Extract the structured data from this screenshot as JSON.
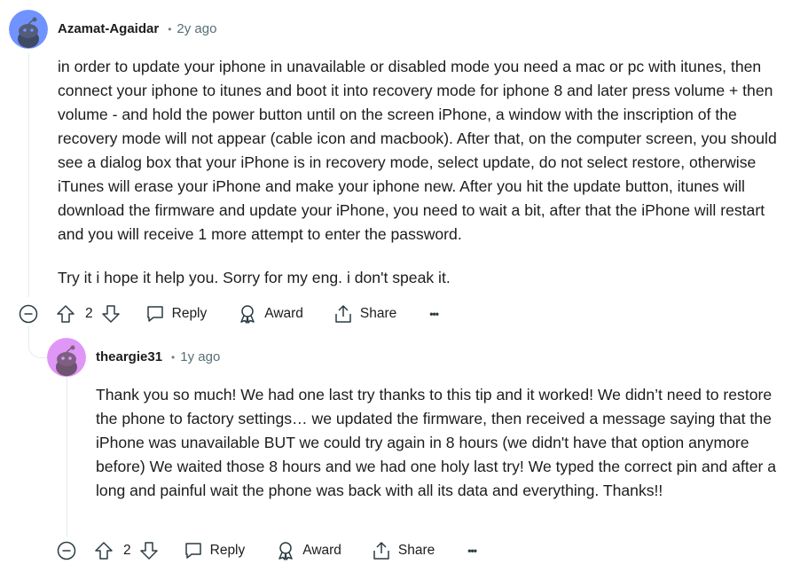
{
  "comments": [
    {
      "author": "Azamat-Agaidar",
      "time": "2y ago",
      "paragraphs": [
        "in order to update your iphone in unavailable or disabled mode you need a mac or pc with itunes, then connect your iphone to itunes and boot it into recovery mode for iphone 8 and later press volume + then volume - and hold the power button until on the screen iPhone, a window with the inscription of the recovery mode will not appear (cable icon and macbook). After that, on the computer screen, you should see a dialog box that your iPhone is in recovery mode, select update, do not select restore, otherwise iTunes will erase your iPhone and make your iphone new. After you hit the update button, itunes will download the firmware and update your iPhone, you need to wait a bit, after that the iPhone will restart and you will receive 1 more attempt to enter the password.",
        "Try it i hope it help you. Sorry for my eng. i don't speak it."
      ],
      "score": "2",
      "avatar_color": "#7193ff",
      "actions": {
        "reply": "Reply",
        "award": "Award",
        "share": "Share",
        "more": "•••"
      }
    },
    {
      "author": "theargie31",
      "time": "1y ago",
      "paragraphs": [
        "Thank you so much! We had one last try thanks to this tip and it worked! We didn’t need to restore the phone to factory settings… we updated the firmware, then received a message saying that the iPhone was unavailable BUT we could try again in 8 hours (we didn't have that option anymore before) We waited those 8 hours and we had one holy last try! We typed the correct pin and after a long and painful wait the phone was back with all its data and everything. Thanks!!"
      ],
      "score": "2",
      "avatar_color": "#e096f6",
      "actions": {
        "reply": "Reply",
        "award": "Award",
        "share": "Share",
        "more": "•••"
      }
    }
  ],
  "meta_separator": "•"
}
